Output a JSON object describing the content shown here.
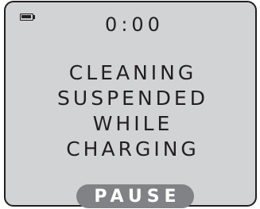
{
  "status": {
    "battery_icon": "battery-charging-icon",
    "timer": "0:00"
  },
  "message": {
    "lines": [
      "CLEANING",
      "SUSPENDED",
      "WHILE",
      "CHARGING"
    ]
  },
  "controls": {
    "pause_label": "PAUSE"
  },
  "colors": {
    "screen_bg": "#d1d3d4",
    "text": "#231f20",
    "button_bg": "#808285",
    "button_text": "#ffffff"
  }
}
